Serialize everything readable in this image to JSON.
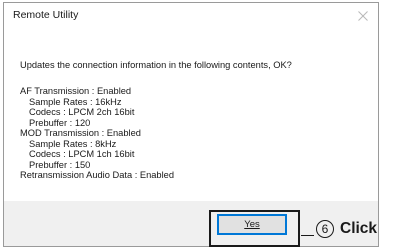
{
  "window": {
    "title": "Remote Utility",
    "close_icon": "close-icon"
  },
  "message": "Updates the connection information in the following contents, OK?",
  "details": [
    {
      "text": "AF Transmission : Enabled",
      "indent": false
    },
    {
      "text": "Sample Rates : 16kHz",
      "indent": true
    },
    {
      "text": "Codecs : LPCM 2ch 16bit",
      "indent": true
    },
    {
      "text": "Prebuffer : 120",
      "indent": true
    },
    {
      "text": "MOD Transmission : Enabled",
      "indent": false
    },
    {
      "text": "Sample Rates : 8kHz",
      "indent": true
    },
    {
      "text": "Codecs : LPCM 1ch 16bit",
      "indent": true
    },
    {
      "text": "Prebuffer : 150",
      "indent": true
    },
    {
      "text": "Retransmission Audio Data : Enabled",
      "indent": false
    }
  ],
  "buttons": {
    "yes_label": "Yes"
  },
  "callout": {
    "step_number": "6",
    "step_text": "Click"
  },
  "colors": {
    "focus_border": "#0078d7",
    "footer_bg": "#f0f0f0"
  }
}
